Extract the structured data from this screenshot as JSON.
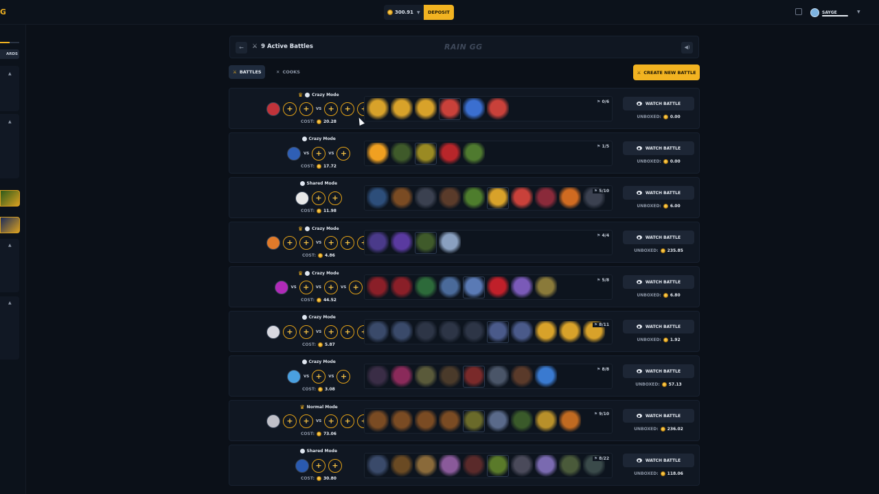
{
  "topbar": {
    "balance": "300.91",
    "deposit_label": "DEPOSIT",
    "username": "SAYGE"
  },
  "sidebar": {
    "tab_label": "ARDS"
  },
  "header": {
    "title": "9 Active Battles",
    "brand": "RAIN GG"
  },
  "tabs": {
    "battles_label": "BATTLES",
    "cooks_label": "COOKS",
    "create_label": "CREATE NEW BATTLE"
  },
  "labels": {
    "vs": "VS",
    "cost": "COST:",
    "unboxed": "UNBOXED:",
    "watch": "WATCH BATTLE",
    "slot": "+"
  },
  "battles": [
    {
      "mode": "Crazy Mode",
      "crown": true,
      "cost": "20.28",
      "progress": "0/6",
      "unboxed": "0.00",
      "teams": [
        3,
        3
      ],
      "avatar_color": "#c0333a",
      "cases": [
        "#d8a22a",
        "#d8a22a",
        "#d8a22a",
        "#c9413a",
        "#3b6fd0",
        "#c9413a"
      ]
    },
    {
      "mode": "Crazy Mode",
      "crown": false,
      "cost": "17.72",
      "progress": "1/5",
      "unboxed": "0.00",
      "teams": [
        1,
        1,
        1
      ],
      "avatar_color": "#2f5fb5",
      "cases": [
        "#f0a021",
        "#3f5a2a",
        "#9a8a23",
        "#b8262a",
        "#4f7a2f"
      ]
    },
    {
      "mode": "Shared Mode",
      "crown": false,
      "cost": "11.98",
      "progress": "5/10",
      "unboxed": "6.00",
      "teams": [
        3
      ],
      "avatar_color": "#e8e8e8",
      "cases": [
        "#2d4e7a",
        "#7a4b23",
        "#3b4150",
        "#5a3b2a",
        "#4e7d2d",
        "#d8a22a",
        "#c9413a",
        "#8a2a3a",
        "#d06b21",
        "#3b4150"
      ]
    },
    {
      "mode": "Crazy Mode",
      "crown": true,
      "cost": "4.86",
      "progress": "4/4",
      "unboxed": "235.85",
      "teams": [
        3,
        3
      ],
      "avatar_color": "#e07a2a",
      "cases": [
        "#4a3a8a",
        "#5a3aa0",
        "#3f5a2a",
        "#8aa0c0"
      ]
    },
    {
      "mode": "Crazy Mode",
      "crown": true,
      "cost": "44.52",
      "progress": "5/8",
      "unboxed": "6.80",
      "teams": [
        1,
        1,
        1,
        1
      ],
      "avatar_color": "#b02ab8",
      "cases": [
        "#8a1f28",
        "#8a1f28",
        "#2d6a3a",
        "#4a6a9a",
        "#5a7ab5",
        "#c0202a",
        "#7a5ab8",
        "#8a7a3a"
      ]
    },
    {
      "mode": "Crazy Mode",
      "crown": false,
      "cost": "5.87",
      "progress": "8/11",
      "unboxed": "1.92",
      "teams": [
        3,
        3
      ],
      "avatar_color": "#d8d8e0",
      "cases": [
        "#3a4a6a",
        "#3a4a6a",
        "#2d3546",
        "#2d3546",
        "#2d3546",
        "#4a5a8a",
        "#4a5a8a",
        "#d8a22a",
        "#d8a22a",
        "#d8a22a"
      ]
    },
    {
      "mode": "Crazy Mode",
      "crown": false,
      "cost": "3.08",
      "progress": "8/8",
      "unboxed": "57.13",
      "teams": [
        1,
        1,
        1
      ],
      "avatar_color": "#4aa0e0",
      "cases": [
        "#3a2d46",
        "#8a2a5a",
        "#5a5a3a",
        "#4a3a2a",
        "#7a2a2a",
        "#4a5568",
        "#5a3a2a",
        "#3a7ad0"
      ]
    },
    {
      "mode": "Normal Mode",
      "crown": true,
      "cost": "73.06",
      "progress": "9/10",
      "unboxed": "236.02",
      "teams": [
        3,
        3
      ],
      "avatar_color": "#c0c0c8",
      "cases": [
        "#7a4b23",
        "#7a4b23",
        "#7a4b23",
        "#7a4b23",
        "#6a6a2a",
        "#5a6a8a",
        "#3a5a2a",
        "#b8902a",
        "#c06a21"
      ]
    },
    {
      "mode": "Shared Mode",
      "crown": false,
      "cost": "30.80",
      "progress": "8/22",
      "unboxed": "118.06",
      "teams": [
        3
      ],
      "avatar_color": "#2a5ab0",
      "cases": [
        "#3a4a6a",
        "#6a4a23",
        "#8a6a3a",
        "#8a5a9a",
        "#5a2a2a",
        "#5a7a2a",
        "#4a4a5a",
        "#7a6ab0",
        "#4a5a3a",
        "#3a4a4a"
      ]
    }
  ]
}
